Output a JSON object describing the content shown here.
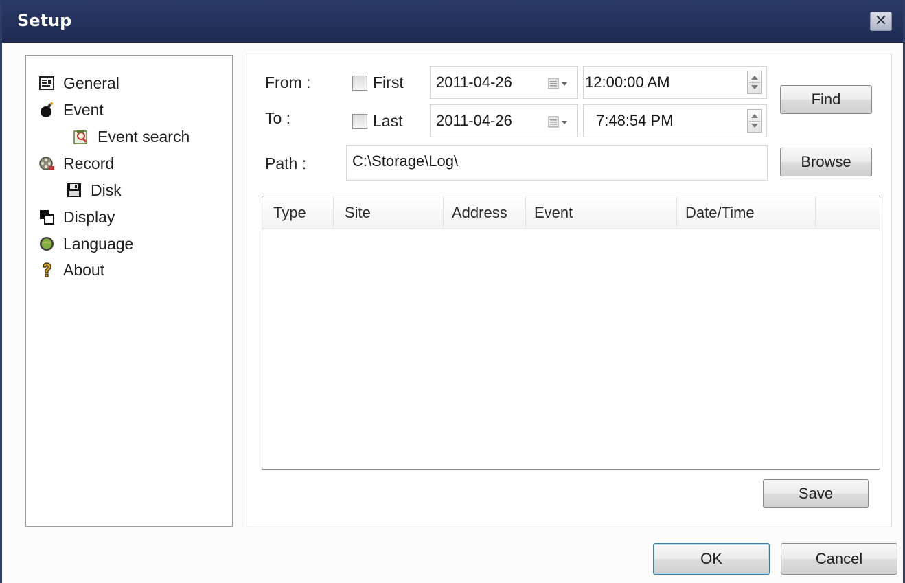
{
  "window": {
    "title": "Setup",
    "close_glyph": "✕"
  },
  "nav": {
    "items": [
      {
        "label": "General",
        "icon": "general-icon"
      },
      {
        "label": "Event",
        "icon": "event-bomb-icon"
      },
      {
        "label": "Event search",
        "icon": "event-search-icon"
      },
      {
        "label": "Record",
        "icon": "record-film-icon"
      },
      {
        "label": "Disk",
        "icon": "disk-icon"
      },
      {
        "label": "Display",
        "icon": "display-icon"
      },
      {
        "label": "Language",
        "icon": "globe-icon"
      },
      {
        "label": "About",
        "icon": "question-icon"
      }
    ]
  },
  "search": {
    "from_label": "From :",
    "to_label": "To :",
    "path_label": "Path :",
    "first_label": "First",
    "last_label": "Last",
    "first_checked": false,
    "last_checked": false,
    "from_date": "2011-04-26",
    "to_date": "2011-04-26",
    "from_time": "12:00:00 AM",
    "to_time": "7:48:54 PM",
    "path_value": "C:\\Storage\\Log\\",
    "find_label": "Find",
    "browse_label": "Browse"
  },
  "table": {
    "columns": [
      "Type",
      "Site",
      "Address",
      "Event",
      "Date/Time"
    ],
    "rows": []
  },
  "actions": {
    "save_label": "Save",
    "ok_label": "OK",
    "cancel_label": "Cancel"
  }
}
